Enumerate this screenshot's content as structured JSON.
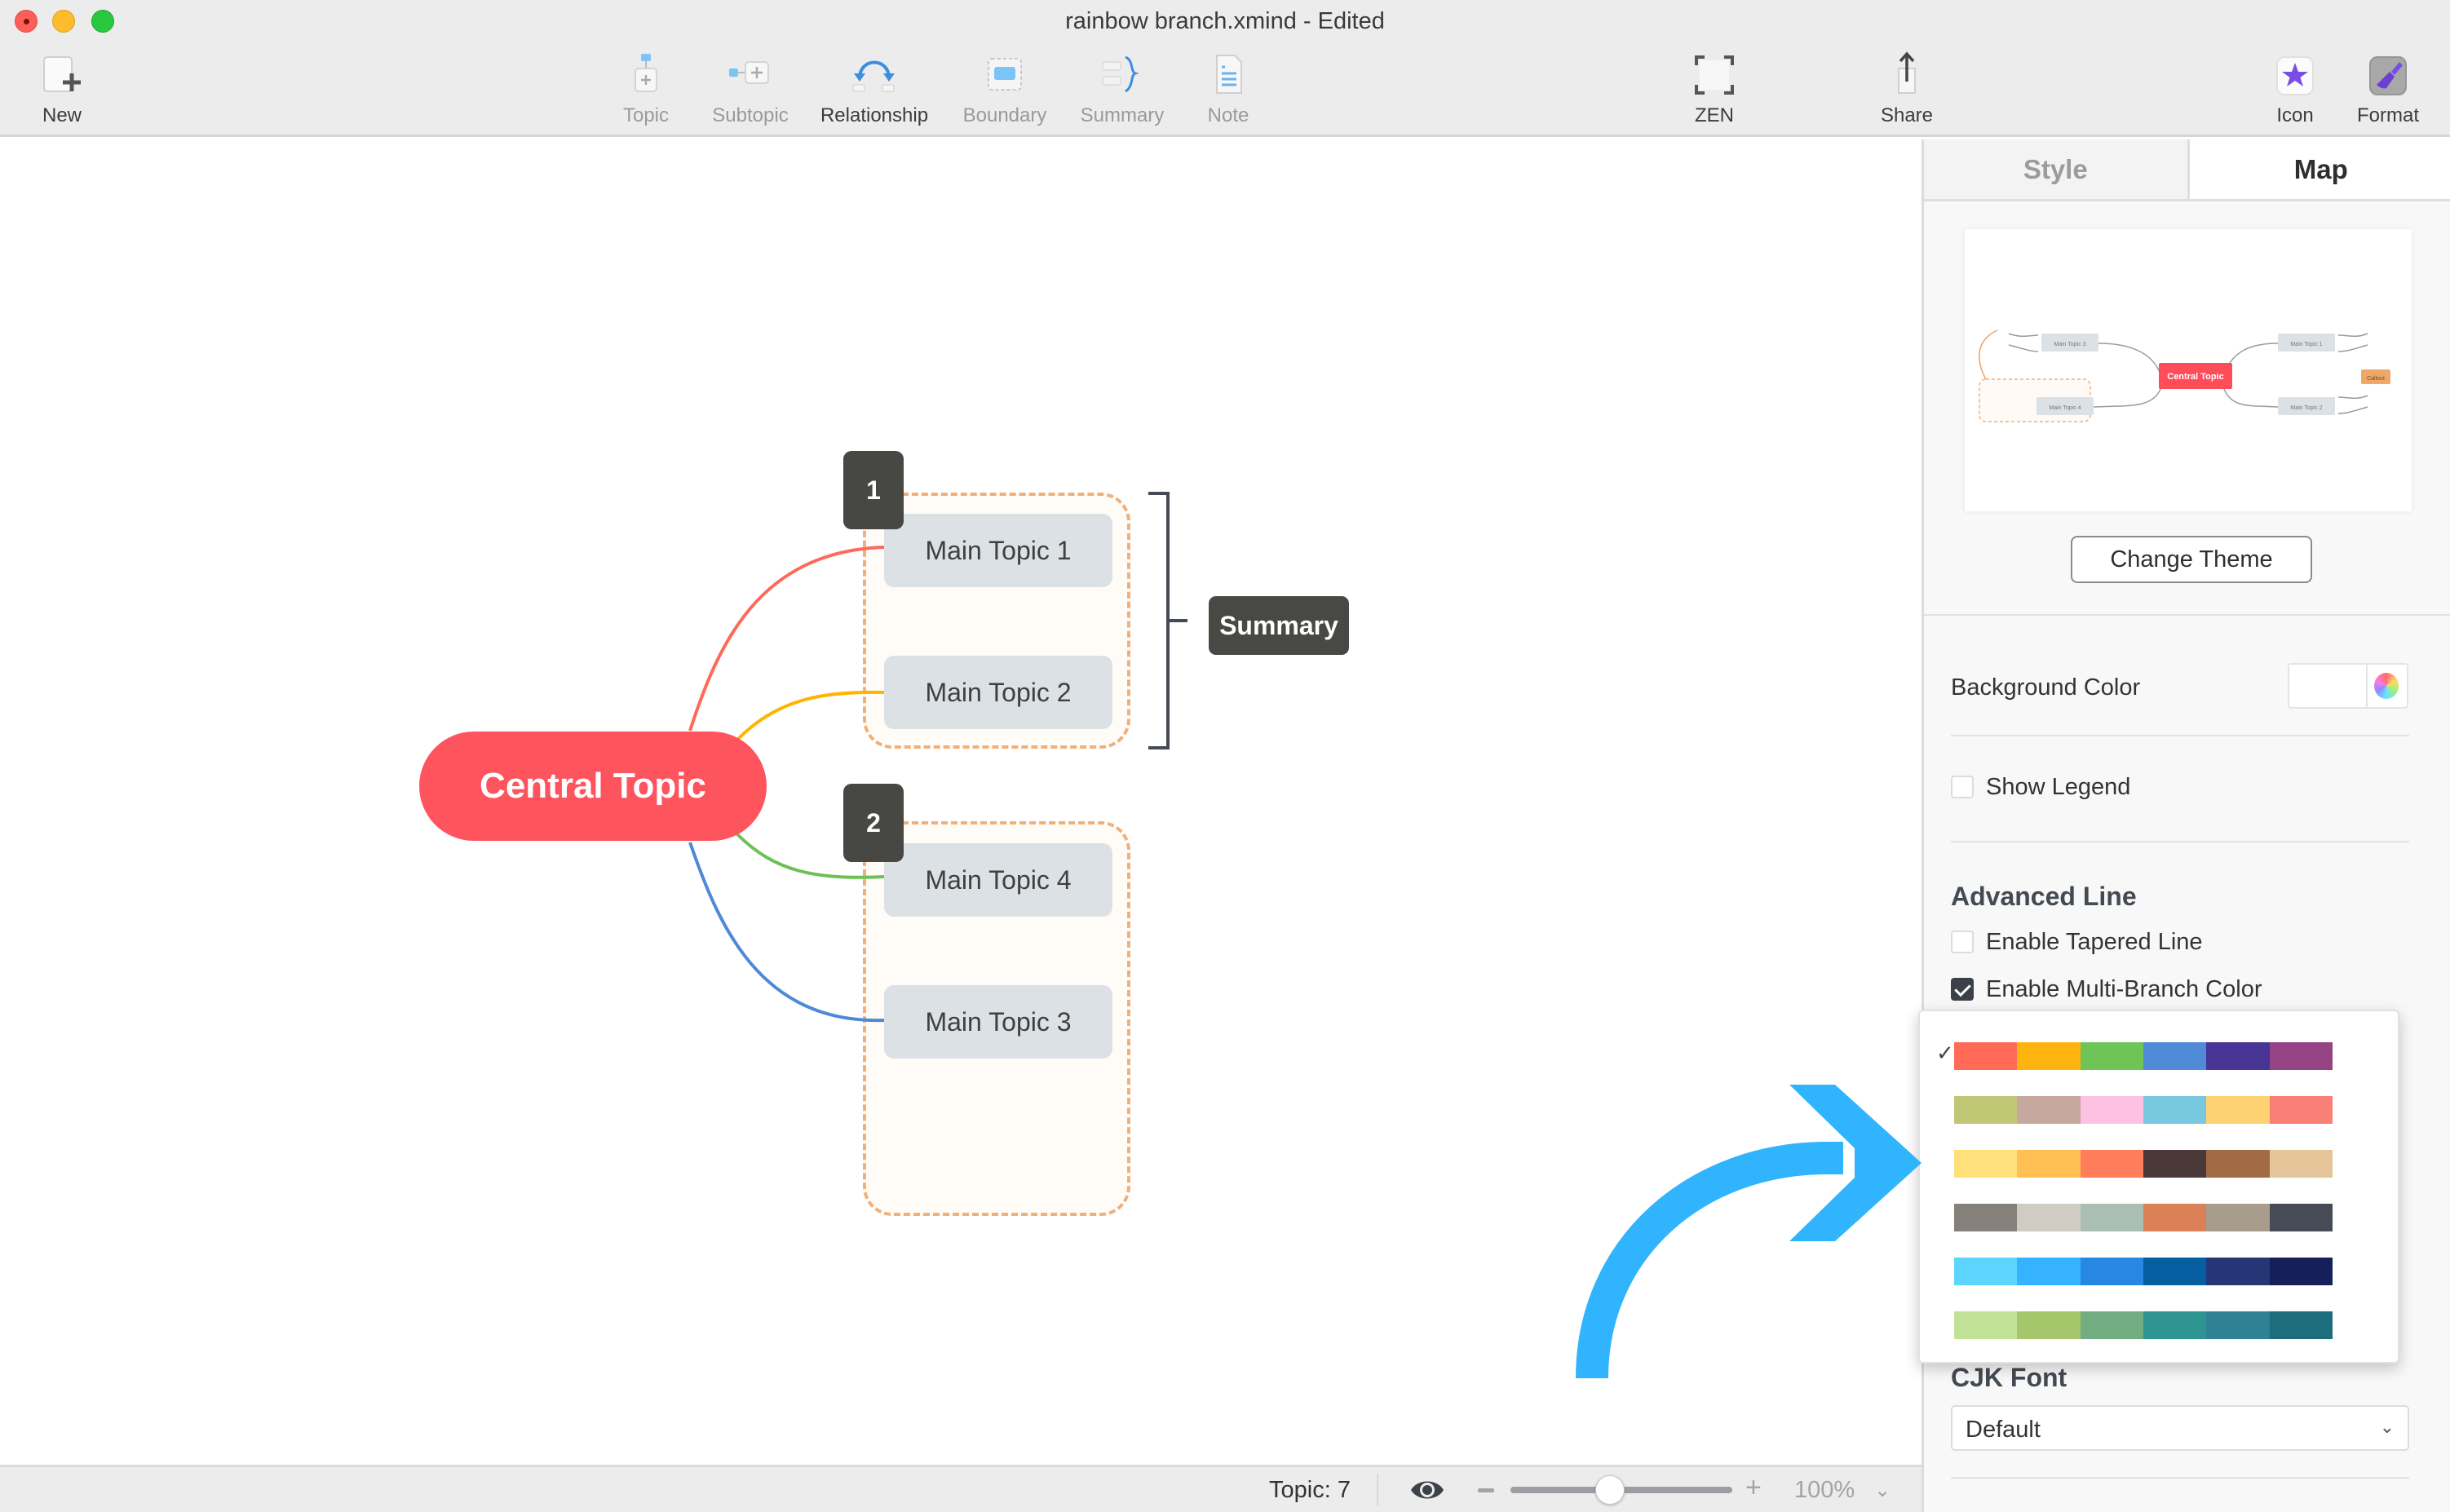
{
  "window": {
    "title": "rainbow branch.xmind - Edited"
  },
  "toolbar": {
    "new": "New",
    "topic": "Topic",
    "subtopic": "Subtopic",
    "relationship": "Relationship",
    "boundary": "Boundary",
    "summary": "Summary",
    "note": "Note",
    "zen": "ZEN",
    "share": "Share",
    "icon": "Icon",
    "format": "Format"
  },
  "map": {
    "central_topic": "Central Topic",
    "topics": [
      "Main Topic 1",
      "Main Topic 2",
      "Main Topic 4",
      "Main Topic 3"
    ],
    "markers": [
      "1",
      "2"
    ],
    "summary": "Summary",
    "branch_colors": [
      "#fe6a5a",
      "#ffb400",
      "#6cc155",
      "#4e89d8"
    ],
    "boundary_color": "#f1b07a"
  },
  "status": {
    "topic_count": "Topic: 7",
    "zoom_minus": "−",
    "zoom_plus": "+",
    "zoom_value": "100%",
    "zoom_chevron": "⌄",
    "zoom_fraction": 0.45
  },
  "panel": {
    "tabs": [
      "Style",
      "Map"
    ],
    "active_tab": "Map",
    "preview": {
      "central": "Central Topic",
      "topics": [
        "Main Topic 3",
        "Main Topic 4",
        "Main Topic 1",
        "Main Topic 2"
      ],
      "callout": "Callout"
    },
    "change_theme": "Change Theme",
    "background_color_label": "Background Color",
    "background_color_value": "#ffffff",
    "show_legend": {
      "label": "Show Legend",
      "checked": false
    },
    "advanced_line_title": "Advanced Line",
    "tapered_line": {
      "label": "Enable Tapered Line",
      "checked": false
    },
    "multi_branch": {
      "label": "Enable Multi-Branch Color",
      "checked": true
    },
    "cjk_font_title": "CJK Font",
    "cjk_font_value": "Default",
    "select_chevron": "⌄"
  },
  "palette_popup": {
    "selected_index": 0,
    "check_glyph": "✓",
    "palettes": [
      [
        "#ff6b57",
        "#ffb30f",
        "#6fc456",
        "#508bd7",
        "#483495",
        "#964385"
      ],
      [
        "#c1c775",
        "#c6a89f",
        "#fdc1e2",
        "#78c9df",
        "#fed272",
        "#f97f77"
      ],
      [
        "#ffe07a",
        "#ffbf52",
        "#ff7d5a",
        "#4b3939",
        "#a36b45",
        "#e3c599"
      ],
      [
        "#85817a",
        "#d0ccc3",
        "#abbeb4",
        "#da8158",
        "#a89c8c",
        "#474b55"
      ],
      [
        "#5cd6ff",
        "#35b3ff",
        "#2688e2",
        "#045ea0",
        "#263575",
        "#15205a"
      ],
      [
        "#c1e296",
        "#a5c66b",
        "#71ad80",
        "#2d9491",
        "#2e8294",
        "#1e6d7c"
      ]
    ]
  },
  "annotation": {
    "arrow_color": "#30b4fd"
  }
}
